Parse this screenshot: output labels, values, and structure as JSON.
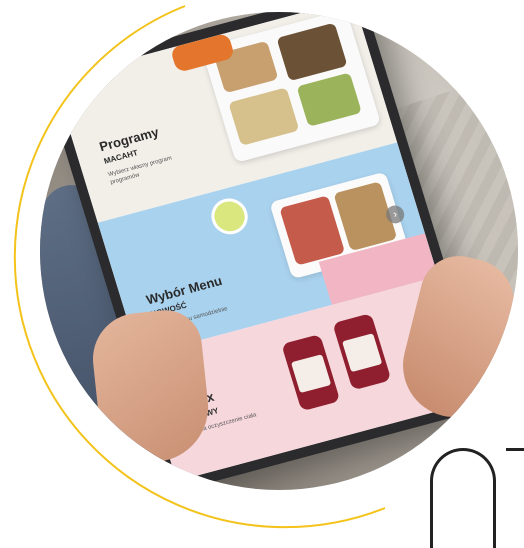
{
  "colors": {
    "accent_arc": "#f3c31b",
    "panel_programs": "#f2efe9",
    "panel_menu": "#a9d2ee",
    "panel_detox": "#f6d7dc"
  },
  "tablet": {
    "panels": [
      {
        "title": "Programy",
        "subtitle": "MACAHT",
        "description": "Wybierz własny program programów"
      },
      {
        "title": "Wybór Menu",
        "subtitle": "NOWOŚĆ",
        "description": "Wybierz menu samodzielnie"
      },
      {
        "title": "Detox",
        "subtitle": "SOKOWY",
        "description": "Soki na oczyszczenie ciała"
      }
    ],
    "arrows": [
      "›",
      "›"
    ]
  },
  "icons": {
    "next_arrow": "chevron-right-icon"
  }
}
